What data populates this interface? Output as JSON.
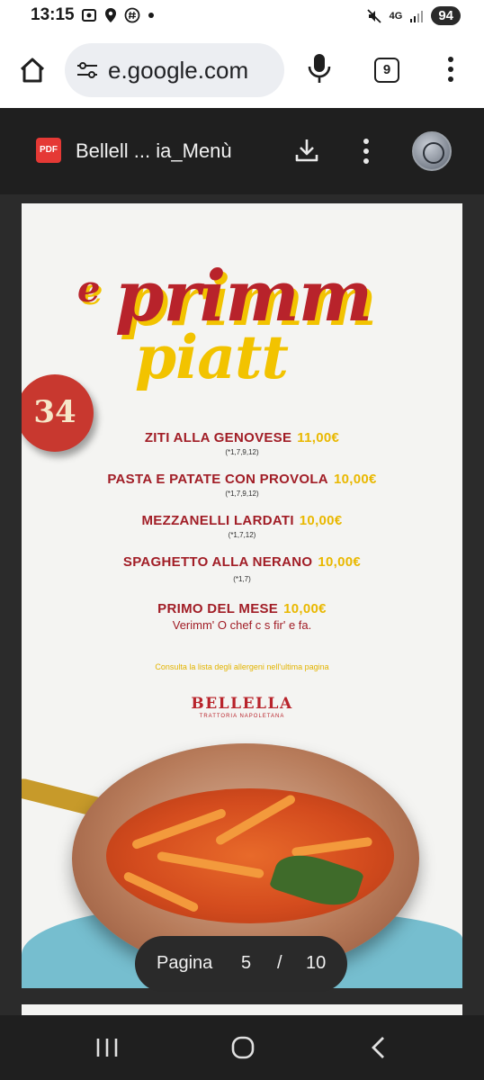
{
  "status_bar": {
    "time": "13:15",
    "network": "4G",
    "battery": "94"
  },
  "browser": {
    "url": "e.google.com",
    "tab_count": "9"
  },
  "pdf_viewer": {
    "title": "Bellell ... ia_Menù"
  },
  "menu": {
    "heading_e": "e",
    "heading_primm": "primm",
    "heading_piatt": "piatt",
    "disc_number": "34",
    "dishes": [
      {
        "name": "ZITI ALLA GENOVESE",
        "price": "11,00€",
        "allergens": "(*1,7,9,12)"
      },
      {
        "name": "PASTA E PATATE CON PROVOLA",
        "price": "10,00€",
        "allergens": "(*1,7,9,12)"
      },
      {
        "name": "MEZZANELLI LARDATI",
        "price": "10,00€",
        "allergens": "(*1,7,12)"
      },
      {
        "name": "SPAGHETTO ALLA NERANO",
        "price": "10,00€",
        "allergens": "(*1,7)"
      },
      {
        "name": "PRIMO DEL MESE",
        "price": "10,00€",
        "description": "Verimm' O chef c s fir' e fa."
      }
    ],
    "allergen_note": "Consulta la lista degli allergeni nell'ultima pagina",
    "brand_name": "BELLELLA",
    "brand_sub": "TRATTORIA NAPOLETANA"
  },
  "page_indicator": {
    "label": "Pagina",
    "current": "5",
    "separator": "/",
    "total": "10"
  },
  "colors": {
    "brand_red": "#b8232b",
    "price_yellow": "#e9b800",
    "viewer_dark": "#1f1f1f"
  }
}
